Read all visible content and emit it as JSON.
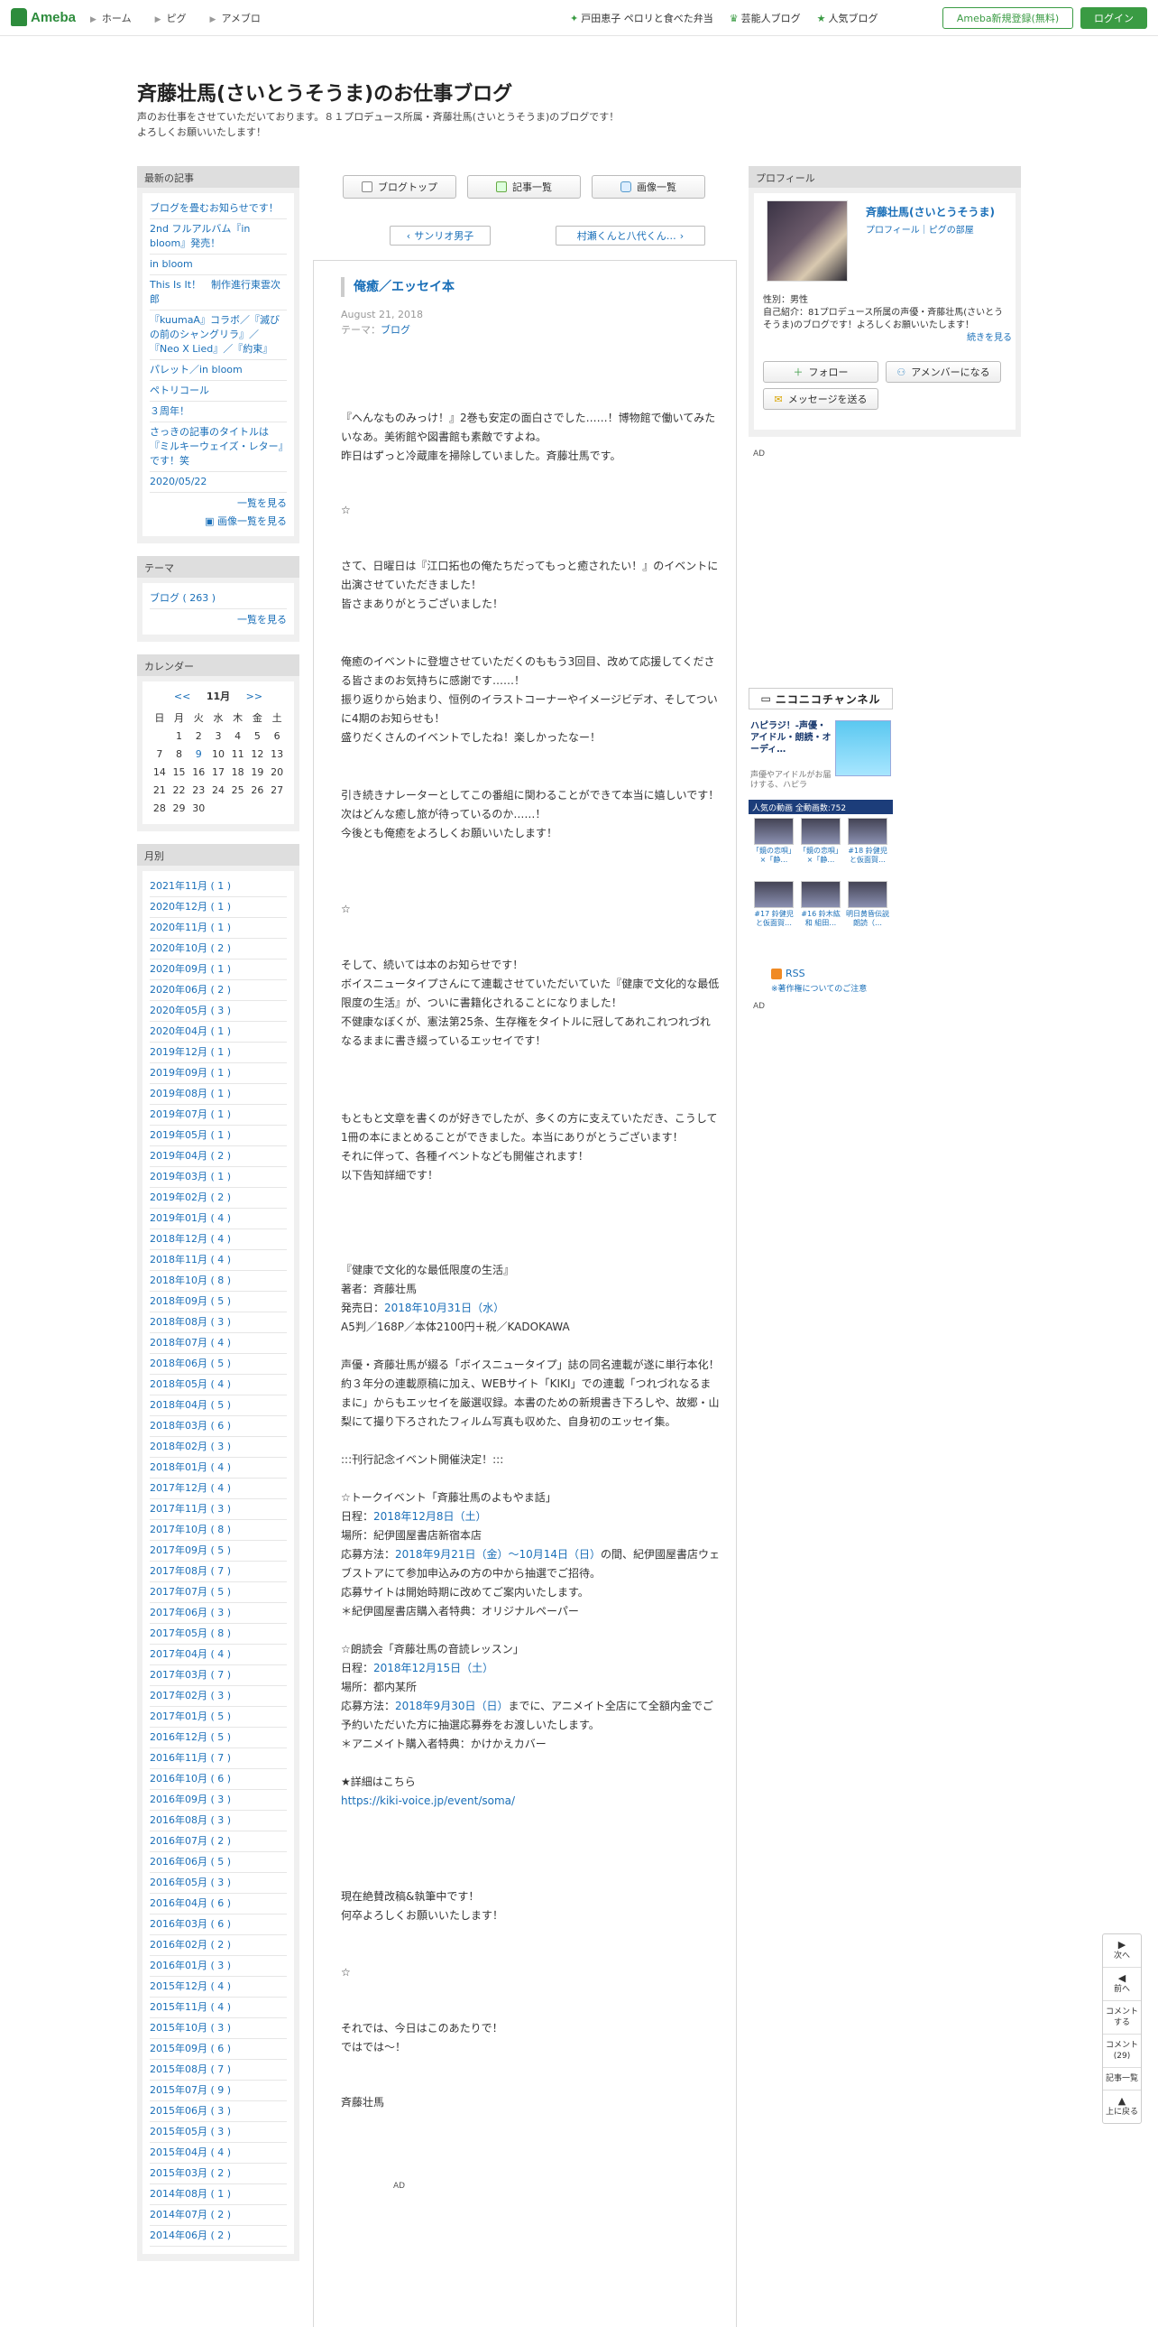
{
  "topbar": {
    "logo": "Ameba",
    "nav": [
      "ホーム",
      "ピグ",
      "アメブロ"
    ],
    "links": [
      "戸田恵子 ペロリと食べた弁当",
      "芸能人ブログ",
      "人気ブログ"
    ],
    "register": "Ameba新規登録(無料)",
    "login": "ログイン"
  },
  "header": {
    "title": "斉藤壮馬(さいとうそうま)のお仕事ブログ",
    "desc1": "声のお仕事をさせていただいております。８１プロデュース所属・斉藤壮馬(さいとうそうま)のブログです！",
    "desc2": "よろしくお願いいたします！"
  },
  "recent": {
    "heading": "最新の記事",
    "items": [
      "ブログを畳むお知らせです！",
      "2nd フルアルバム『in bloom』発売！",
      "in bloom",
      "This Is It！　制作進行東雲次郎",
      "『kuumaA』コラボ／『滅びの前のシャングリラ』／『Neo X Lied』／『約束』",
      "パレット／in bloom",
      "ペトリコール",
      "３周年！",
      "さっきの記事のタイトルは『ミルキーウェイズ・レター』です！笑",
      "2020/05/22"
    ],
    "more": "一覧を見る",
    "more_img": "画像一覧を見る"
  },
  "theme": {
    "heading": "テーマ",
    "item": "ブログ ( 263 )",
    "more": "一覧を見る"
  },
  "calendar": {
    "heading": "カレンダー",
    "prev": "<<",
    "month": "11月",
    "next": ">>",
    "weekdays": [
      "日",
      "月",
      "火",
      "水",
      "木",
      "金",
      "土"
    ],
    "weeks": [
      [
        "",
        "1",
        "2",
        "3",
        "4",
        "5",
        "6"
      ],
      [
        "7",
        "8",
        "9",
        "10",
        "11",
        "12",
        "13"
      ],
      [
        "14",
        "15",
        "16",
        "17",
        "18",
        "19",
        "20"
      ],
      [
        "21",
        "22",
        "23",
        "24",
        "25",
        "26",
        "27"
      ],
      [
        "28",
        "29",
        "30",
        "",
        "",
        "",
        ""
      ]
    ],
    "link_day": "9"
  },
  "monthly": {
    "heading": "月別",
    "items": [
      "2021年11月 ( 1 )",
      "2020年12月 ( 1 )",
      "2020年11月 ( 1 )",
      "2020年10月 ( 2 )",
      "2020年09月 ( 1 )",
      "2020年06月 ( 2 )",
      "2020年05月 ( 3 )",
      "2020年04月 ( 1 )",
      "2019年12月 ( 1 )",
      "2019年09月 ( 1 )",
      "2019年08月 ( 1 )",
      "2019年07月 ( 1 )",
      "2019年05月 ( 1 )",
      "2019年04月 ( 2 )",
      "2019年03月 ( 1 )",
      "2019年02月 ( 2 )",
      "2019年01月 ( 4 )",
      "2018年12月 ( 4 )",
      "2018年11月 ( 4 )",
      "2018年10月 ( 8 )",
      "2018年09月 ( 5 )",
      "2018年08月 ( 3 )",
      "2018年07月 ( 4 )",
      "2018年06月 ( 5 )",
      "2018年05月 ( 4 )",
      "2018年04月 ( 5 )",
      "2018年03月 ( 6 )",
      "2018年02月 ( 3 )",
      "2018年01月 ( 4 )",
      "2017年12月 ( 4 )",
      "2017年11月 ( 3 )",
      "2017年10月 ( 8 )",
      "2017年09月 ( 5 )",
      "2017年08月 ( 7 )",
      "2017年07月 ( 5 )",
      "2017年06月 ( 3 )",
      "2017年05月 ( 8 )",
      "2017年04月 ( 4 )",
      "2017年03月 ( 7 )",
      "2017年02月 ( 3 )",
      "2017年01月 ( 5 )",
      "2016年12月 ( 5 )",
      "2016年11月 ( 7 )",
      "2016年10月 ( 6 )",
      "2016年09月 ( 3 )",
      "2016年08月 ( 3 )",
      "2016年07月 ( 2 )",
      "2016年06月 ( 5 )",
      "2016年05月 ( 3 )",
      "2016年04月 ( 6 )",
      "2016年03月 ( 6 )",
      "2016年02月 ( 2 )",
      "2016年01月 ( 3 )",
      "2015年12月 ( 4 )",
      "2015年11月 ( 4 )",
      "2015年10月 ( 3 )",
      "2015年09月 ( 6 )",
      "2015年08月 ( 7 )",
      "2015年07月 ( 9 )",
      "2015年06月 ( 3 )",
      "2015年05月 ( 3 )",
      "2015年04月 ( 4 )",
      "2015年03月 ( 2 )",
      "2014年08月 ( 1 )",
      "2014年07月 ( 2 )",
      "2014年06月 ( 2 )"
    ]
  },
  "tabs": [
    "ブログトップ",
    "記事一覧",
    "画像一覧"
  ],
  "pager": {
    "prev": "サンリオ男子",
    "next": "村瀬くんと八代くん…"
  },
  "article": {
    "title": "俺癒／エッセイ本",
    "date": "August 21, 2018",
    "theme_label": "テーマ：",
    "theme": "ブログ",
    "p1": "『へんなものみっけ！』2巻も安定の面白さでした……！博物館で働いてみたいなあ。美術館や図書館も素敵ですよね。\n昨日はずっと冷蔵庫を掃除していました。斉藤壮馬です。",
    "star1": "☆",
    "p2": "さて、日曜日は『江口拓也の俺たちだってもっと癒されたい！』のイベントに出演させていただきました！\n皆さまありがとうございました！",
    "p3": "俺癒のイベントに登壇させていただくのももう3回目、改めて応援してくださる皆さまのお気持ちに感謝です……！\n振り返りから始まり、恒例のイラストコーナーやイメージビデオ、そしてついに4期のお知らせも！\n盛りだくさんのイベントでしたね！楽しかったなー！",
    "p4": "引き続きナレーターとしてこの番組に関わることができて本当に嬉しいです！\n次はどんな癒し旅が待っているのか……！\n今後とも俺癒をよろしくお願いいたします！",
    "star2": "☆",
    "p5": "そして、続いては本のお知らせです！\nボイスニュータイプさんにて連載させていただいていた『健康で文化的な最低限度の生活』が、ついに書籍化されることになりました！\n不健康なぼくが、憲法第25条、生存権をタイトルに冠してあれこれつれづれなるままに書き綴っているエッセイです！",
    "p6": "もともと文章を書くのが好きでしたが、多くの方に支えていただき、こうして1冊の本にまとめることができました。本当にありがとうございます！\nそれに伴って、各種イベントなども開催されます！\n以下告知詳細です！",
    "book_title": "『健康で文化的な最低限度の生活』",
    "book_author": "著者：斉藤壮馬",
    "book_release_label": "発売日：",
    "book_release": "2018年10月31日（水）",
    "book_spec": "A5判／168P／本体2100円＋税／KADOKAWA",
    "book_desc": "声優・斉藤壮馬が綴る「ボイスニュータイプ」誌の同名連載が遂に単行本化！　約３年分の連載原稿に加え、WEBサイト「KIKI」での連載「つれづれなるままに」からもエッセイを厳選収録。本書のための新規書き下ろしや、故郷・山梨にて撮り下ろされたフィルム写真も収めた、自身初のエッセイ集。",
    "event_heading": ":::刊行記念イベント開催決定！:::",
    "ev1_title": "☆トークイベント「斉藤壮馬のよもやま話」",
    "ev1_date_label": "日程：",
    "ev1_date": "2018年12月8日（土）",
    "ev1_place": "場所：紀伊國屋書店新宿本店",
    "ev1_method_label": "応募方法：",
    "ev1_method_link": "2018年9月21日（金）～10月14日（日）",
    "ev1_method_rest": "の間、紀伊國屋書店ウェブストアにて参加申込みの方の中から抽選でご招待。",
    "ev1_note": "応募サイトは開始時期に改めてご案内いたします。",
    "ev1_bonus": "＊紀伊國屋書店購入者特典：オリジナルペーパー",
    "ev2_title": "☆朗読会「斉藤壮馬の音読レッスン」",
    "ev2_date_label": "日程：",
    "ev2_date": "2018年12月15日（土）",
    "ev2_place": "場所：都内某所",
    "ev2_method_label": "応募方法：",
    "ev2_method_link": "2018年9月30日（日）",
    "ev2_method_rest": "までに、アニメイト全店にて全額内金でご予約いただいた方に抽選応募券をお渡しいたします。",
    "ev2_bonus": "＊アニメイト購入者特典：かけかえカバー",
    "detail_label": "★詳細はこちら",
    "detail_url": "https://kiki-voice.jp/event/soma/",
    "p7": "現在絶賛改稿&執筆中です！\n何卒よろしくお願いいたします！",
    "star3": "☆",
    "p8": "それでは、今日はこのあたりで！\nではでは～！",
    "sign": "斉藤壮馬",
    "ad": "AD"
  },
  "profile": {
    "heading": "プロフィール",
    "name": "斉藤壮馬(さいとうそうま)",
    "links": "プロフィール｜ピグの部屋",
    "gender": "性別：男性",
    "intro": "自己紹介：81プロデュース所属の声優・斉藤壮馬(さいとうそうま)のブログです！よろしくお願いいたします！",
    "more": "続きを見る",
    "follow": "フォロー",
    "amember": "アメンバーになる",
    "message": "メッセージを送る",
    "ad": "AD"
  },
  "nico": {
    "header": "ニコニコチャンネル",
    "title": "ハピラジ！-声優・アイドル・朗読・オーディ…",
    "desc": "声優やアイドルがお届けする、ハピラ",
    "bar": "人気の動画 全動画数:752",
    "videos": [
      "「鏡の恋唄」×「静…",
      "「鏡の恋唄」×「静…",
      "#18 鈴健児と仮面賀…",
      "#17 鈴健児と仮面賀…",
      "#16 鈴木紘和 組田…",
      "明日黄昏伝説　朗読（…"
    ]
  },
  "rss": {
    "label": "RSS",
    "note": "※著作権についてのご注意",
    "ad": "AD"
  },
  "floatnav": {
    "next": "次へ",
    "prev": "前へ",
    "comment": "コメントする",
    "comments": "コメント(29)",
    "list": "記事一覧",
    "top": "上に戻る"
  }
}
